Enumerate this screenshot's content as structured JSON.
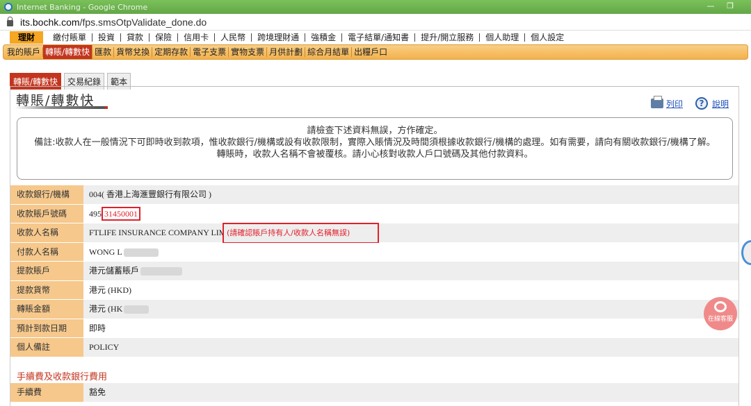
{
  "browser": {
    "window_title": "Internet Banking - Google Chrome",
    "url_host": "its.bochk.com",
    "url_path": "/fps.smsOtpValidate_done.do"
  },
  "main_menu": [
    "理財",
    "繳付賬單",
    "投資",
    "貸款",
    "保險",
    "信用卡",
    "人民幣",
    "跨境理財通",
    "強積金",
    "電子結單/通知書",
    "提升/開立服務",
    "個人助理",
    "個人設定"
  ],
  "sub_menu": [
    "我的賬戶",
    "轉賬/轉數快",
    "匯款",
    "貨幣兌換",
    "定期存款",
    "電子支票",
    "實物支票",
    "月供計劃",
    "綜合月結單",
    "出糧戶口"
  ],
  "tabs": [
    "轉賬/轉數快",
    "交易紀錄",
    "範本"
  ],
  "page": {
    "title": "轉賬/轉數快",
    "print_label": "列印",
    "help_label": "說明"
  },
  "notice": {
    "line1": "請檢查下述資料無誤，方作確定。",
    "line2": "備註:收款人在一般情況下可即時收到款項，惟收款銀行/機構或設有收款限制，實際入賬情況及時間須根據收款銀行/機構的處理。如有需要，請向有關收款銀行/機構了解。",
    "line3": "轉賬時，收款人名稱不會被覆核。請小心核對收款人戶口號碼及其他付款資料。"
  },
  "details": {
    "bank_label": "收款銀行/機構",
    "bank_value": "004( 香港上海滙豐銀行有限公司 )",
    "account_label": "收款賬戶號碼",
    "account_prefix": "495",
    "account_highlight": "31450001",
    "payee_label": "收款人名稱",
    "payee_value": "FTLIFE INSURANCE COMPANY LIMITED",
    "payee_warning": "(請確認賬戶持有人/收款人名稱無誤)",
    "payer_label": "付款人名稱",
    "payer_value": "WONG L",
    "from_account_label": "提款賬戶",
    "from_account_value": "港元儲蓄賬戶",
    "currency_label": "提款貨幣",
    "currency_value": "港元 (HKD)",
    "amount_label": "轉賬金額",
    "amount_value": "港元 (HK",
    "arrival_label": "預計到款日期",
    "arrival_value": "即時",
    "remark_label": "個人備註",
    "remark_value": "POLICY"
  },
  "fees": {
    "section_title": "手續費及收款銀行費用",
    "fee_label": "手續費",
    "fee_value": "豁免"
  },
  "chat_label": "在線客服"
}
